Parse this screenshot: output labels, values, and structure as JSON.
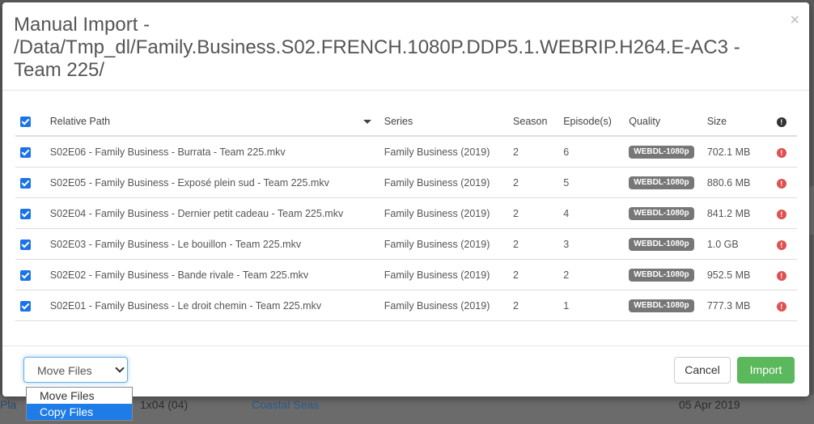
{
  "background": {
    "row_left": "Pla",
    "row_episode": "1x04 (04)",
    "row_title": "Coastal Seas",
    "row_date": "05 Apr 2019"
  },
  "modal": {
    "title": "Manual Import - /Data/Tmp_dl/Family.Business.S02.FRENCH.1080P.DDP5.1.WEBRIP.H264.E-AC3 - Team 225/",
    "close_glyph": "×"
  },
  "table": {
    "headers": {
      "path": "Relative Path",
      "series": "Series",
      "season": "Season",
      "episodes": "Episode(s)",
      "quality": "Quality",
      "size": "Size"
    },
    "rows": [
      {
        "path": "S02E06 - Family Business - Burrata - Team 225.mkv",
        "series": "Family Business (2019)",
        "season": "2",
        "episodes": "6",
        "quality": "WEBDL-1080p",
        "size": "702.1 MB"
      },
      {
        "path": "S02E05 - Family Business - Exposé plein sud - Team 225.mkv",
        "series": "Family Business (2019)",
        "season": "2",
        "episodes": "5",
        "quality": "WEBDL-1080p",
        "size": "880.6 MB"
      },
      {
        "path": "S02E04 - Family Business - Dernier petit cadeau - Team 225.mkv",
        "series": "Family Business (2019)",
        "season": "2",
        "episodes": "4",
        "quality": "WEBDL-1080p",
        "size": "841.2 MB"
      },
      {
        "path": "S02E03 - Family Business - Le bouillon - Team 225.mkv",
        "series": "Family Business (2019)",
        "season": "2",
        "episodes": "3",
        "quality": "WEBDL-1080p",
        "size": "1.0 GB"
      },
      {
        "path": "S02E02 - Family Business - Bande rivale - Team 225.mkv",
        "series": "Family Business (2019)",
        "season": "2",
        "episodes": "2",
        "quality": "WEBDL-1080p",
        "size": "952.5 MB"
      },
      {
        "path": "S02E01 - Family Business - Le droit chemin - Team 225.mkv",
        "series": "Family Business (2019)",
        "season": "2",
        "episodes": "1",
        "quality": "WEBDL-1080p",
        "size": "777.3 MB"
      }
    ]
  },
  "footer": {
    "mode_select_value": "Move Files",
    "mode_options": [
      "Move Files",
      "Copy Files"
    ],
    "highlighted_option": "Copy Files",
    "cancel_label": "Cancel",
    "import_label": "Import"
  },
  "colors": {
    "checkbox": "#1a73e8",
    "import_button": "#5cb85c",
    "warning": "#e05050",
    "quality_badge": "#777777"
  }
}
